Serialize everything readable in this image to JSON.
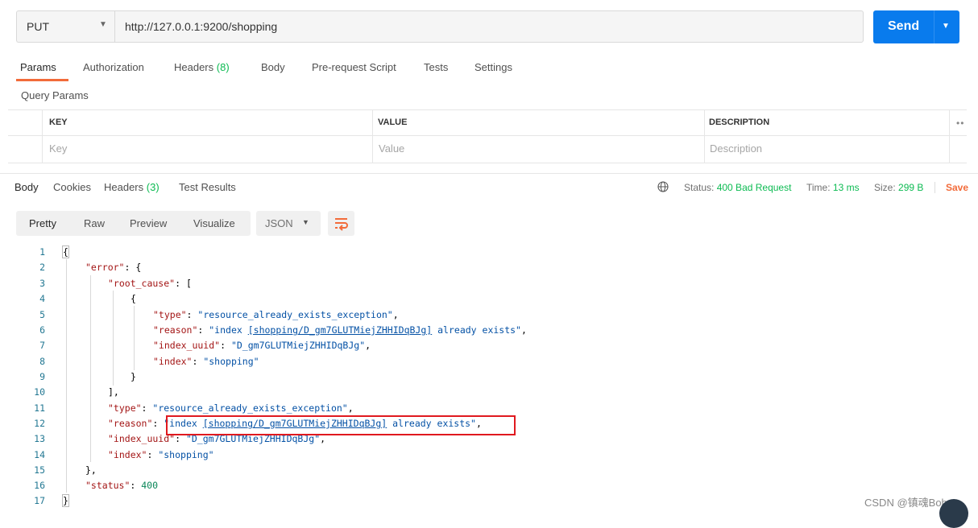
{
  "request": {
    "method": "PUT",
    "url": "http://127.0.0.1:9200/shopping",
    "send_label": "Send",
    "tabs": [
      {
        "label": "Params"
      },
      {
        "label": "Authorization"
      },
      {
        "label": "Headers",
        "count": "(8)"
      },
      {
        "label": "Body"
      },
      {
        "label": "Pre-request Script"
      },
      {
        "label": "Tests"
      },
      {
        "label": "Settings"
      }
    ],
    "query_params_label": "Query Params",
    "table": {
      "headers": [
        "KEY",
        "VALUE",
        "DESCRIPTION"
      ],
      "placeholders": [
        "Key",
        "Value",
        "Description"
      ],
      "more": "••"
    }
  },
  "response": {
    "tabs": [
      {
        "label": "Body"
      },
      {
        "label": "Cookies"
      },
      {
        "label": "Headers",
        "count": "(3)"
      },
      {
        "label": "Test Results"
      }
    ],
    "status_label": "Status:",
    "status_value": "400 Bad Request",
    "time_label": "Time:",
    "time_value": "13 ms",
    "size_label": "Size:",
    "size_value": "299 B",
    "save_label": "Save",
    "view_buttons": [
      "Pretty",
      "Raw",
      "Preview",
      "Visualize"
    ],
    "format": "JSON",
    "line_numbers": [
      "1",
      "2",
      "3",
      "4",
      "5",
      "6",
      "7",
      "8",
      "9",
      "10",
      "11",
      "12",
      "13",
      "14",
      "15",
      "16",
      "17"
    ],
    "body": {
      "error_key": "\"error\"",
      "root_cause_key": "\"root_cause\"",
      "type_key": "\"type\"",
      "reason_key": "\"reason\"",
      "index_uuid_key": "\"index_uuid\"",
      "index_key": "\"index\"",
      "status_key": "\"status\"",
      "type_value": "\"resource_already_exists_exception\"",
      "reason_prefix": "\"index ",
      "reason_link": "[shopping/D_gm7GLUTMiejZHHIDqBJg]",
      "reason_suffix": " already exists\"",
      "index_uuid_value": "\"D_gm7GLUTMiejZHHIDqBJg\"",
      "index_value": "\"shopping\"",
      "status_value": "400"
    }
  },
  "watermark": "CSDN @镇魂Boby",
  "colors": {
    "send": "#097bed",
    "accent": "#f26b3a",
    "success_green": "#0cbb52",
    "highlight_box": "#e0191f"
  }
}
